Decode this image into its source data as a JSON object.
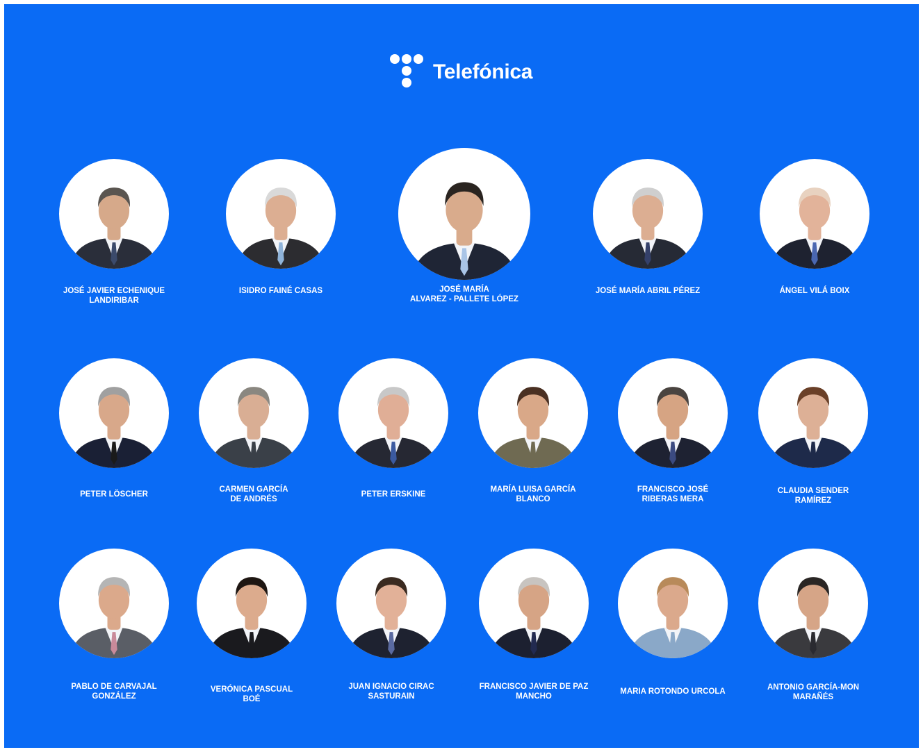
{
  "brand": {
    "name": "Telefónica",
    "logo_icon": "telefonica-dots-logo",
    "background_color": "#0A6BF5",
    "text_color": "#FFFFFF"
  },
  "board": {
    "rows": [
      {
        "members": [
          {
            "name_lines": [
              "JOSÉ JAVIER ECHENIQUE",
              "LANDIRIBAR"
            ],
            "portrait": {
              "hair": "#5a5550",
              "suit": "#2a2e3a",
              "tie": "#3b4a6b",
              "skin": "#d6a98a"
            }
          },
          {
            "name_lines": [
              "ISIDRO FAINÉ CASAS"
            ],
            "portrait": {
              "hair": "#d9d9d9",
              "suit": "#2c2c30",
              "tie": "#8fb3d9",
              "skin": "#dcae92"
            }
          },
          {
            "name_lines": [
              "JOSÉ MARÍA",
              "ALVAREZ - PALLETE LÓPEZ"
            ],
            "portrait": {
              "hair": "#2a2420",
              "suit": "#1f2535",
              "tie": "#a9c4e6",
              "skin": "#d9ab8c"
            }
          },
          {
            "name_lines": [
              "JOSÉ MARÍA ABRIL PÉREZ"
            ],
            "portrait": {
              "hair": "#cfcfcf",
              "suit": "#262a35",
              "tie": "#34406a",
              "skin": "#dcae92"
            }
          },
          {
            "name_lines": [
              "ÁNGEL VILÁ BOIX"
            ],
            "portrait": {
              "hair": "#e8d2c0",
              "suit": "#1e2230",
              "tie": "#4a67b0",
              "skin": "#e2b39a"
            }
          }
        ]
      },
      {
        "members": [
          {
            "name_lines": [
              "PETER LÖSCHER"
            ],
            "portrait": {
              "hair": "#a0a0a0",
              "suit": "#1a2035",
              "tie": "#1a1a1a",
              "skin": "#d8a88a"
            }
          },
          {
            "name_lines": [
              "CARMEN GARCÍA",
              "DE ANDRÉS"
            ],
            "portrait": {
              "hair": "#8a8780",
              "suit": "#3a4048",
              "tie": "#3a4048",
              "skin": "#d9ae94"
            }
          },
          {
            "name_lines": [
              "PETER ERSKINE"
            ],
            "portrait": {
              "hair": "#c8c8c8",
              "suit": "#262833",
              "tie": "#3b5aa0",
              "skin": "#e0ae96"
            }
          },
          {
            "name_lines": [
              "MARÍA LUISA GARCÍA",
              "BLANCO"
            ],
            "portrait": {
              "hair": "#4a3022",
              "suit": "#6f6a52",
              "tie": "#6f6a52",
              "skin": "#d9a888"
            }
          },
          {
            "name_lines": [
              "FRANCISCO JOSÉ",
              "RIBERAS MERA"
            ],
            "portrait": {
              "hair": "#4a4440",
              "suit": "#1e2232",
              "tie": "#3b4a80",
              "skin": "#d6a483"
            }
          },
          {
            "name_lines": [
              "CLAUDIA SENDER",
              "RAMÍREZ"
            ],
            "portrait": {
              "hair": "#6a4028",
              "suit": "#1e2a4a",
              "tie": "#1e2a4a",
              "skin": "#ddb096"
            }
          }
        ]
      },
      {
        "members": [
          {
            "name_lines": [
              "PABLO DE CARVAJAL",
              "GONZÁLEZ"
            ],
            "portrait": {
              "hair": "#b5b5b5",
              "suit": "#5a5e66",
              "tie": "#c98a9a",
              "skin": "#dba98b"
            }
          },
          {
            "name_lines": [
              "VERÓNICA  PASCUAL",
              "BOÉ"
            ],
            "portrait": {
              "hair": "#1e1612",
              "suit": "#1a1a1e",
              "tie": "#1a1a1e",
              "skin": "#dcab8d"
            }
          },
          {
            "name_lines": [
              "JUAN IGNACIO CIRAC",
              "SASTURAIN"
            ],
            "portrait": {
              "hair": "#3a2a20",
              "suit": "#1e2230",
              "tie": "#5a6aa0",
              "skin": "#e2b198"
            }
          },
          {
            "name_lines": [
              "FRANCISCO JAVIER DE PAZ",
              "MANCHO"
            ],
            "portrait": {
              "hair": "#c8c4c0",
              "suit": "#1c2030",
              "tie": "#222a50",
              "skin": "#d6a485"
            }
          },
          {
            "name_lines": [
              "MARIA ROTONDO URCOLA"
            ],
            "portrait": {
              "hair": "#b88a5a",
              "suit": "#8aa8c8",
              "tie": "#8aa8c8",
              "skin": "#dba98c"
            }
          },
          {
            "name_lines": [
              "ANTONIO GARCÍA-MON",
              "MARAÑÉS"
            ],
            "portrait": {
              "hair": "#2a2624",
              "suit": "#3a3a3e",
              "tie": "#2a2a30",
              "skin": "#d6a587"
            }
          }
        ]
      }
    ]
  }
}
